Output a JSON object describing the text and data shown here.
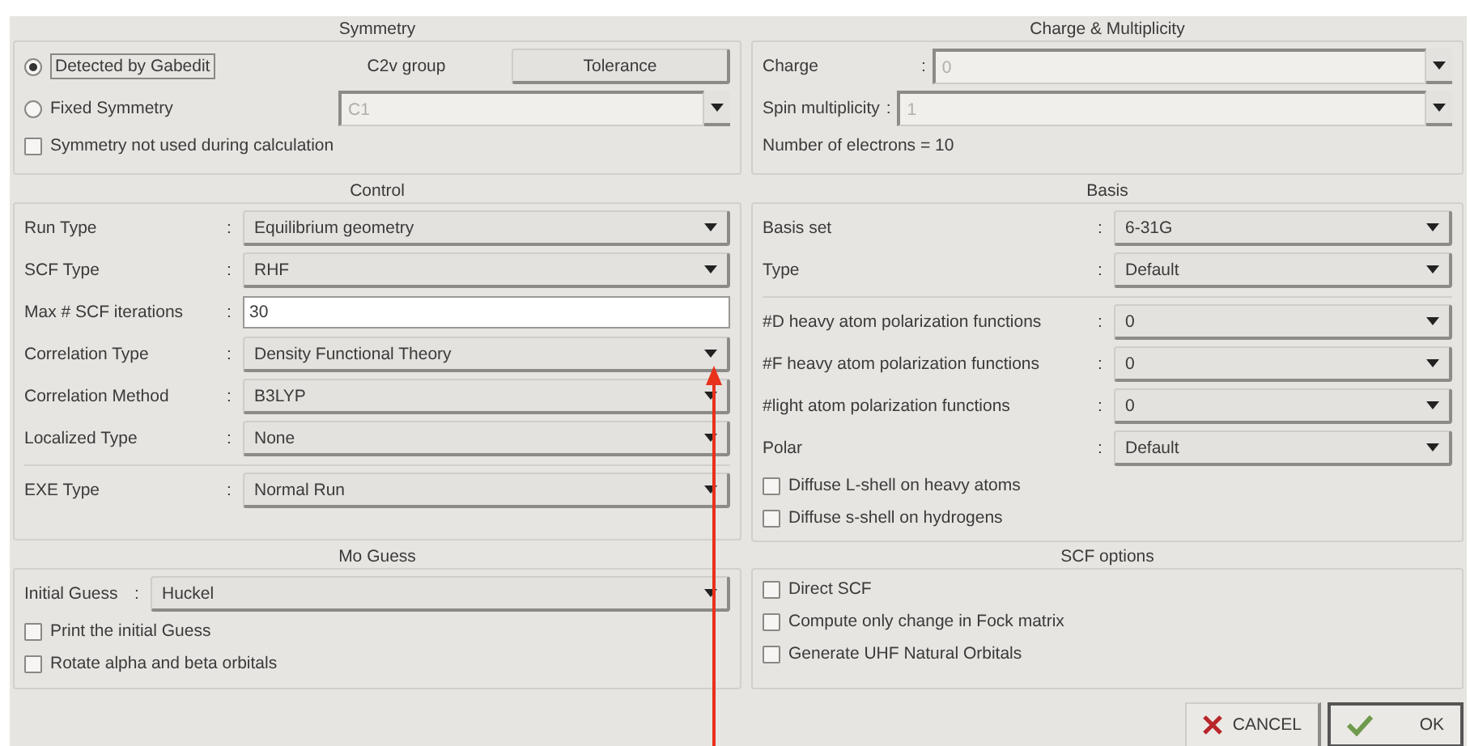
{
  "symmetry": {
    "title": "Symmetry",
    "options": [
      {
        "label": "Detected by Gabedit",
        "selected": true
      },
      {
        "label": "Fixed Symmetry",
        "selected": false
      }
    ],
    "group": "C2v group",
    "tolerance_button": "Tolerance",
    "fixed_value": {
      "value": "C1",
      "disabled": true
    },
    "checks": [
      {
        "label": "Symmetry not used during calculation",
        "checked": false
      }
    ]
  },
  "charge_multiplicity": {
    "title": "Charge & Multiplicity",
    "fields": [
      {
        "label": "Charge",
        "colon": ":",
        "value": "0",
        "disabled": true
      },
      {
        "label": "Spin multiplicity",
        "colon": ":",
        "value": "1",
        "disabled": true
      }
    ],
    "electrons": "Number of electrons = 10"
  },
  "control": {
    "title": "Control",
    "rows": [
      {
        "kind": "combo",
        "label": "Run Type",
        "colon": ":",
        "value": "Equilibrium geometry"
      },
      {
        "kind": "combo",
        "label": "SCF Type",
        "colon": ":",
        "value": "RHF"
      },
      {
        "kind": "entry",
        "label": "Max # SCF iterations",
        "colon": ":",
        "value": "30"
      },
      {
        "kind": "combo",
        "label": "Correlation Type",
        "colon": ":",
        "value": "Density Functional Theory"
      },
      {
        "kind": "combo",
        "label": "Correlation Method",
        "colon": ":",
        "value": "B3LYP"
      },
      {
        "kind": "combo",
        "label": "Localized Type",
        "colon": ":",
        "value": "None"
      },
      {
        "kind": "combo",
        "label": "EXE Type",
        "colon": ":",
        "value": "Normal Run",
        "divider_above": true
      }
    ]
  },
  "basis": {
    "title": "Basis",
    "rows": [
      {
        "kind": "combo",
        "label": "Basis set",
        "colon": ":",
        "value": "6-31G"
      },
      {
        "kind": "combo",
        "label": "Type",
        "colon": ":",
        "value": "Default"
      },
      {
        "kind": "combo",
        "label": "#D heavy atom polarization functions",
        "colon": ":",
        "value": "0",
        "divider_above": true
      },
      {
        "kind": "combo",
        "label": "#F heavy atom polarization functions",
        "colon": ":",
        "value": "0"
      },
      {
        "kind": "combo",
        "label": "#light atom polarization functions",
        "colon": ":",
        "value": "0"
      },
      {
        "kind": "combo",
        "label": "Polar",
        "colon": ":",
        "value": "Default"
      }
    ],
    "checks": [
      {
        "label": "Diffuse L-shell on heavy atoms",
        "checked": false
      },
      {
        "label": "Diffuse s-shell on hydrogens",
        "checked": false
      }
    ]
  },
  "mo_guess": {
    "title": "Mo Guess",
    "rows": [
      {
        "kind": "combo",
        "label": "Initial Guess",
        "colon": ":",
        "value": "Huckel"
      }
    ],
    "checks": [
      {
        "label": "Print the initial Guess",
        "checked": false
      },
      {
        "label": "Rotate alpha and beta orbitals",
        "checked": false
      }
    ]
  },
  "scf_options": {
    "title": "SCF options",
    "checks": [
      {
        "label": "Direct SCF",
        "checked": false
      },
      {
        "label": "Compute only change in Fock matrix",
        "checked": false
      },
      {
        "label": "Generate UHF Natural Orbitals",
        "checked": false
      }
    ]
  },
  "buttons": [
    {
      "kind": "cancel",
      "label": "CANCEL"
    },
    {
      "kind": "ok",
      "label": "OK"
    }
  ]
}
